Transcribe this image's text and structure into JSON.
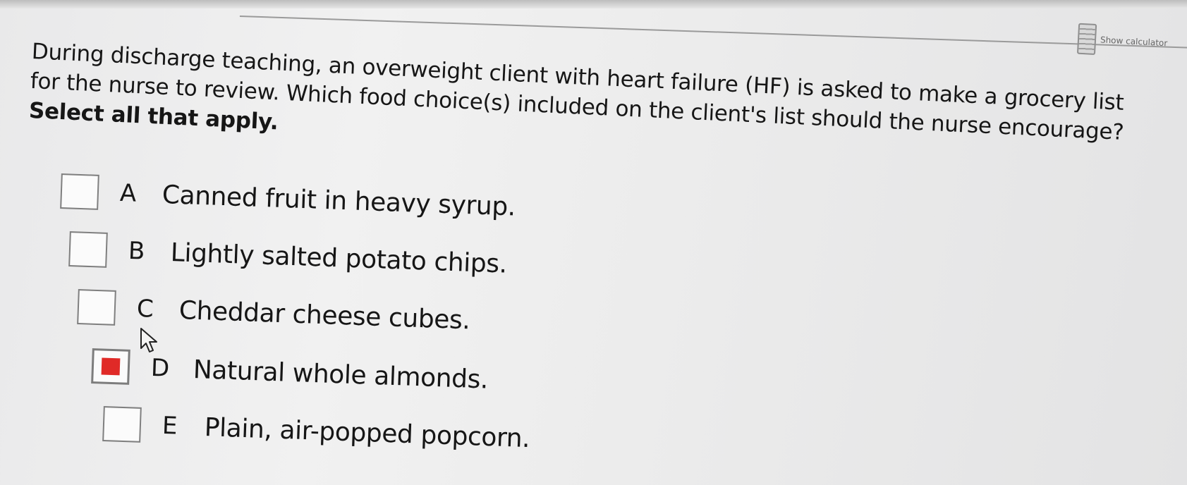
{
  "calculator": {
    "label": "Show calculator",
    "icon": "calculator-icon"
  },
  "question": {
    "text": "During discharge teaching, an overweight client with heart failure (HF) is asked to make a grocery list for the nurse to review. Which food choice(s) included on the client's list should the nurse encourage? ",
    "instruction": "Select all that apply."
  },
  "options": [
    {
      "letter": "A",
      "text": "Canned fruit in heavy syrup.",
      "checked": false
    },
    {
      "letter": "B",
      "text": "Lightly salted potato chips.",
      "checked": false
    },
    {
      "letter": "C",
      "text": "Cheddar cheese cubes.",
      "checked": false
    },
    {
      "letter": "D",
      "text": "Natural whole almonds.",
      "checked": true
    },
    {
      "letter": "E",
      "text": "Plain, air-popped popcorn.",
      "checked": false
    }
  ],
  "colors": {
    "checked_fill": "#e02a27",
    "checkbox_border": "#7f7f7f"
  }
}
